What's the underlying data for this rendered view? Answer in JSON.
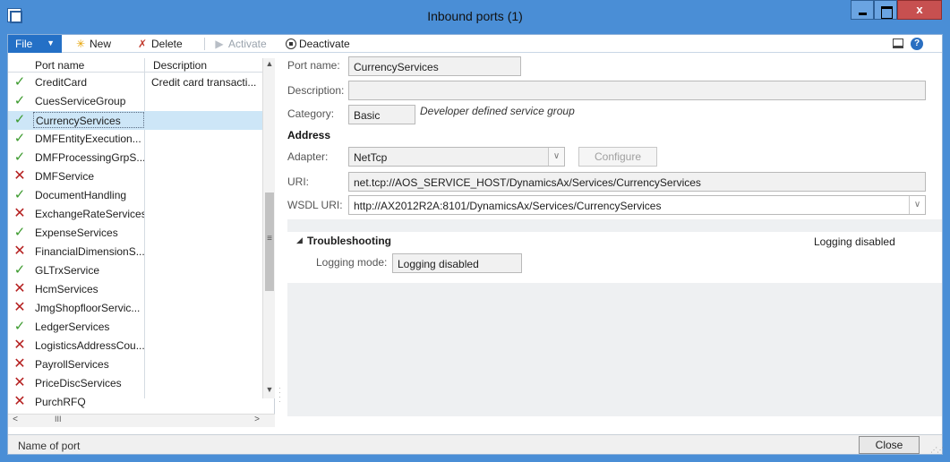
{
  "window": {
    "title": "Inbound ports (1)",
    "controls": {
      "minimize": "",
      "maximize": "",
      "close": "x"
    }
  },
  "actionpane": {
    "file_label": "File",
    "new_label": "New",
    "delete_label": "Delete",
    "activate_label": "Activate",
    "deactivate_label": "Deactivate"
  },
  "grid": {
    "columns": [
      "Port name",
      "Description"
    ],
    "rows": [
      {
        "status": "active",
        "name": "CreditCard",
        "description": "Credit card transacti..."
      },
      {
        "status": "active",
        "name": "CuesServiceGroup",
        "description": ""
      },
      {
        "status": "active",
        "name": "CurrencyServices",
        "description": "",
        "selected": true
      },
      {
        "status": "active",
        "name": "DMFEntityExecution...",
        "description": ""
      },
      {
        "status": "active",
        "name": "DMFProcessingGrpS...",
        "description": ""
      },
      {
        "status": "inactive",
        "name": "DMFService",
        "description": ""
      },
      {
        "status": "active",
        "name": "DocumentHandling",
        "description": ""
      },
      {
        "status": "inactive",
        "name": "ExchangeRateServices",
        "description": ""
      },
      {
        "status": "active",
        "name": "ExpenseServices",
        "description": ""
      },
      {
        "status": "inactive",
        "name": "FinancialDimensionS...",
        "description": ""
      },
      {
        "status": "active",
        "name": "GLTrxService",
        "description": ""
      },
      {
        "status": "inactive",
        "name": "HcmServices",
        "description": ""
      },
      {
        "status": "inactive",
        "name": "JmgShopfloorServic...",
        "description": ""
      },
      {
        "status": "active",
        "name": "LedgerServices",
        "description": ""
      },
      {
        "status": "inactive",
        "name": "LogisticsAddressCou...",
        "description": ""
      },
      {
        "status": "inactive",
        "name": "PayrollServices",
        "description": ""
      },
      {
        "status": "inactive",
        "name": "PriceDiscServices",
        "description": ""
      },
      {
        "status": "inactive",
        "name": "PurchRFQ",
        "description": ""
      }
    ]
  },
  "details": {
    "port_name_label": "Port name:",
    "port_name_value": "CurrencyServices",
    "description_label": "Description:",
    "description_value": "",
    "category_label": "Category:",
    "category_value": "Basic",
    "category_note": "Developer defined service group",
    "address_title": "Address",
    "adapter_label": "Adapter:",
    "adapter_value": "NetTcp",
    "configure_label": "Configure",
    "uri_label": "URI:",
    "uri_value": "net.tcp://AOS_SERVICE_HOST/DynamicsAx/Services/CurrencyServices",
    "wsdl_label": "WSDL URI:",
    "wsdl_value": "http://AX2012R2A:8101/DynamicsAx/Services/CurrencyServices"
  },
  "troubleshooting": {
    "title": "Troubleshooting",
    "summary": "Logging disabled",
    "logging_mode_label": "Logging mode:",
    "logging_mode_value": "Logging disabled"
  },
  "statusbar": {
    "text": "Name of port",
    "close_label": "Close"
  },
  "colors": {
    "title_bar": "#4a8ed6",
    "file_button": "#2470c6",
    "selected_row": "#cde6f7",
    "active_check": "#3d9b2f",
    "inactive_x": "#b51f1f"
  }
}
